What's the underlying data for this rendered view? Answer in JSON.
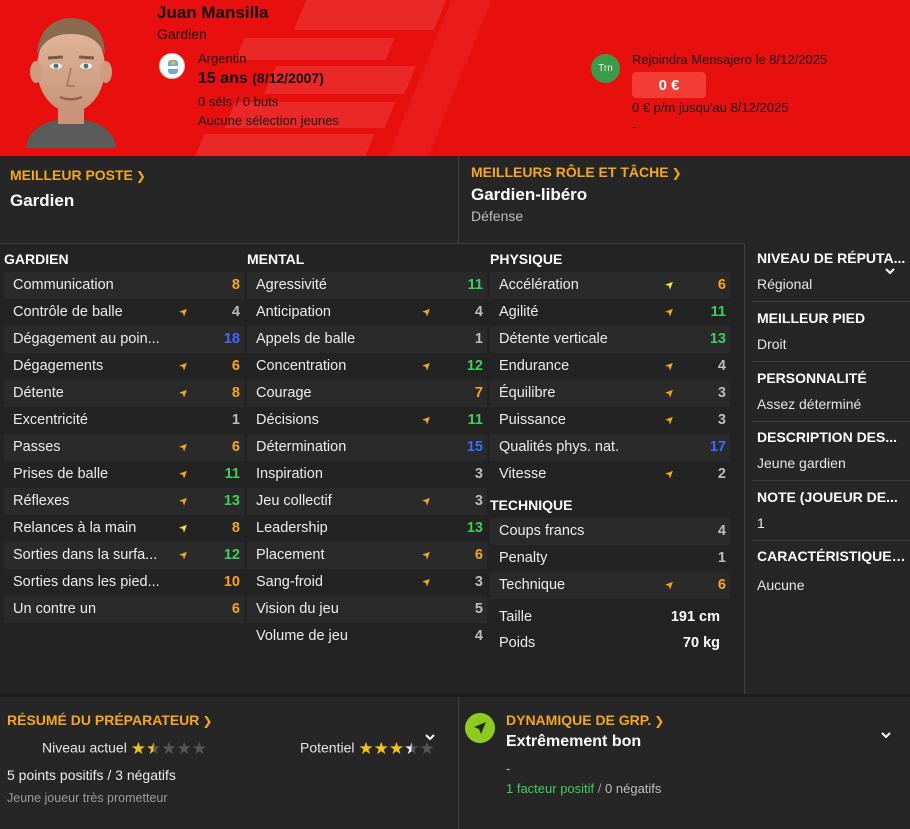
{
  "header": {
    "name": "Juan Mansilla",
    "role": "Gardien",
    "country": "Argentin",
    "age": "15 ans",
    "dob": "(8/12/2007)",
    "caps": "0 séls / 0 buts",
    "youth": "Aucune sélection jeunes",
    "club_badge": "Trn",
    "join": "Rejoindra Mensajero le 8/12/2025",
    "fee": "0 €",
    "wage": "0 € p/m jusqu'au 8/12/2025",
    "dash": "-"
  },
  "best_position": {
    "title": "MEILLEUR POSTE",
    "value": "Gardien"
  },
  "best_role": {
    "title": "MEILLEURS RÔLE ET TÂCHE",
    "value": "Gardien-libéro",
    "duty": "Défense"
  },
  "attributes": {
    "gardien": {
      "title": "GARDIEN",
      "rows": [
        {
          "name": "Communication",
          "value": "8",
          "arrow": "",
          "color": "orange"
        },
        {
          "name": "Contrôle de balle",
          "value": "4",
          "arrow": "up",
          "color": "grey"
        },
        {
          "name": "Dégagement au poin...",
          "value": "18",
          "arrow": "",
          "color": "blue"
        },
        {
          "name": "Dégagements",
          "value": "6",
          "arrow": "up",
          "color": "orange"
        },
        {
          "name": "Détente",
          "value": "8",
          "arrow": "up",
          "color": "orange"
        },
        {
          "name": "Excentricité",
          "value": "1",
          "arrow": "",
          "color": "grey"
        },
        {
          "name": "Passes",
          "value": "6",
          "arrow": "up",
          "color": "orange"
        },
        {
          "name": "Prises de balle",
          "value": "11",
          "arrow": "up",
          "color": "green"
        },
        {
          "name": "Réflexes",
          "value": "13",
          "arrow": "up",
          "color": "green"
        },
        {
          "name": "Relances à la main",
          "value": "8",
          "arrow": "up-yellow",
          "color": "orange"
        },
        {
          "name": "Sorties dans la surfa...",
          "value": "12",
          "arrow": "up",
          "color": "green"
        },
        {
          "name": "Sorties dans les pied...",
          "value": "10",
          "arrow": "",
          "color": "orange"
        },
        {
          "name": "Un contre un",
          "value": "6",
          "arrow": "",
          "color": "orange"
        }
      ]
    },
    "mental": {
      "title": "MENTAL",
      "rows": [
        {
          "name": "Agressivité",
          "value": "11",
          "arrow": "",
          "color": "green"
        },
        {
          "name": "Anticipation",
          "value": "4",
          "arrow": "up",
          "color": "grey"
        },
        {
          "name": "Appels de balle",
          "value": "1",
          "arrow": "",
          "color": "grey"
        },
        {
          "name": "Concentration",
          "value": "12",
          "arrow": "up",
          "color": "green"
        },
        {
          "name": "Courage",
          "value": "7",
          "arrow": "",
          "color": "orange"
        },
        {
          "name": "Décisions",
          "value": "11",
          "arrow": "up",
          "color": "green"
        },
        {
          "name": "Détermination",
          "value": "15",
          "arrow": "",
          "color": "blue"
        },
        {
          "name": "Inspiration",
          "value": "3",
          "arrow": "",
          "color": "grey"
        },
        {
          "name": "Jeu collectif",
          "value": "3",
          "arrow": "up",
          "color": "grey"
        },
        {
          "name": "Leadership",
          "value": "13",
          "arrow": "",
          "color": "green"
        },
        {
          "name": "Placement",
          "value": "6",
          "arrow": "up",
          "color": "orange"
        },
        {
          "name": "Sang-froid",
          "value": "3",
          "arrow": "up",
          "color": "grey"
        },
        {
          "name": "Vision du jeu",
          "value": "5",
          "arrow": "",
          "color": "grey"
        },
        {
          "name": "Volume de jeu",
          "value": "4",
          "arrow": "",
          "color": "grey"
        }
      ]
    },
    "physique": {
      "title": "PHYSIQUE",
      "rows": [
        {
          "name": "Accélération",
          "value": "6",
          "arrow": "up-yellow",
          "color": "orange"
        },
        {
          "name": "Agilité",
          "value": "11",
          "arrow": "up",
          "color": "green"
        },
        {
          "name": "Détente verticale",
          "value": "13",
          "arrow": "",
          "color": "green"
        },
        {
          "name": "Endurance",
          "value": "4",
          "arrow": "up",
          "color": "grey"
        },
        {
          "name": "Équilibre",
          "value": "3",
          "arrow": "up",
          "color": "grey"
        },
        {
          "name": "Puissance",
          "value": "3",
          "arrow": "up",
          "color": "grey"
        },
        {
          "name": "Qualités phys. nat.",
          "value": "17",
          "arrow": "",
          "color": "blue"
        },
        {
          "name": "Vitesse",
          "value": "2",
          "arrow": "up",
          "color": "grey"
        }
      ]
    },
    "technique": {
      "title": "TECHNIQUE",
      "rows": [
        {
          "name": "Coups francs",
          "value": "4",
          "arrow": "",
          "color": "grey"
        },
        {
          "name": "Penalty",
          "value": "1",
          "arrow": "",
          "color": "grey"
        },
        {
          "name": "Technique",
          "value": "6",
          "arrow": "up",
          "color": "orange"
        }
      ]
    },
    "body": {
      "height_label": "Taille",
      "height": "191 cm",
      "weight_label": "Poids",
      "weight": "70 kg"
    }
  },
  "side": {
    "reputation": {
      "title": "NIVEAU DE RÉPUTA...",
      "value": "Régional"
    },
    "foot": {
      "title": "MEILLEUR PIED",
      "value": "Droit"
    },
    "personality": {
      "title": "PERSONNALITÉ",
      "value": "Assez déterminé"
    },
    "description": {
      "title": "DESCRIPTION DES...",
      "value": "Jeune gardien"
    },
    "rating": {
      "title": "NOTE (JOUEUR DE...",
      "value": "1"
    },
    "traits": {
      "title": "CARACTÉRISTIQUES J...",
      "value": "Aucune"
    }
  },
  "coach_report": {
    "title": "RÉSUMÉ DU PRÉPARATEUR",
    "current_label": "Niveau actuel",
    "current_stars": 1.5,
    "potential_label": "Potentiel",
    "potential_stars": 3.5,
    "summary": "5 points positifs / 3 négatifs",
    "note": "Jeune joueur très prometteur"
  },
  "dynamics": {
    "title": "DYNAMIQUE DE GRP.",
    "value": "Extrêmement bon",
    "dash": "-",
    "positive": "1 facteur positif",
    "separator": "/",
    "negative": "0 négatifs"
  },
  "colors": {
    "header_red": "#e8100f",
    "accent_orange": "#f5a623",
    "green": "#3ecf5c",
    "blue": "#3d6bff",
    "grey": "#bdbdbd",
    "dyn_green": "#8ecb21"
  }
}
